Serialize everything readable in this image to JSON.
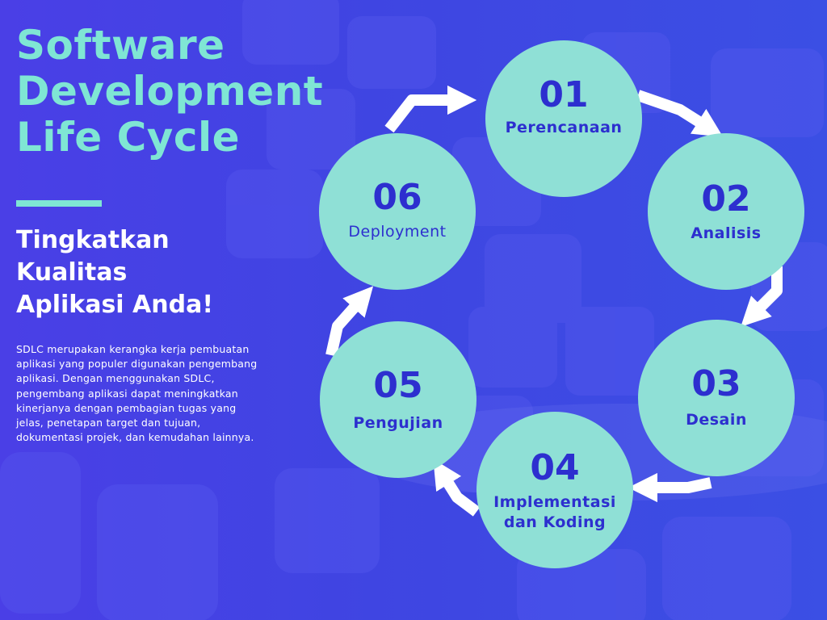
{
  "title_lines": [
    "Software",
    "Development",
    "Life Cycle"
  ],
  "subtitle_lines": [
    "Tingkatkan",
    "Kualitas",
    "Aplikasi Anda!"
  ],
  "description": "SDLC merupakan kerangka kerja pembuatan aplikasi yang populer digunakan pengembang aplikasi. Dengan menggunakan SDLC, pengembang aplikasi dapat meningkatkan  kinerjanya dengan pembagian tugas yang jelas, penetapan target dan tujuan, dokumentasi projek, dan kemudahan lainnya.",
  "steps": [
    {
      "number": "01",
      "label": "Perencanaan"
    },
    {
      "number": "02",
      "label": "Analisis"
    },
    {
      "number": "03",
      "label": "Desain"
    },
    {
      "number": "04",
      "label": "Implementasi dan Koding"
    },
    {
      "number": "05",
      "label": "Pengujian"
    },
    {
      "number": "06",
      "label": "Deployment"
    }
  ],
  "colors": {
    "background": "#3d3fe0",
    "accent": "#7fe6d4",
    "circle": "#8fe0d6",
    "circle_text": "#2d2fcf",
    "arrow": "#ffffff"
  }
}
